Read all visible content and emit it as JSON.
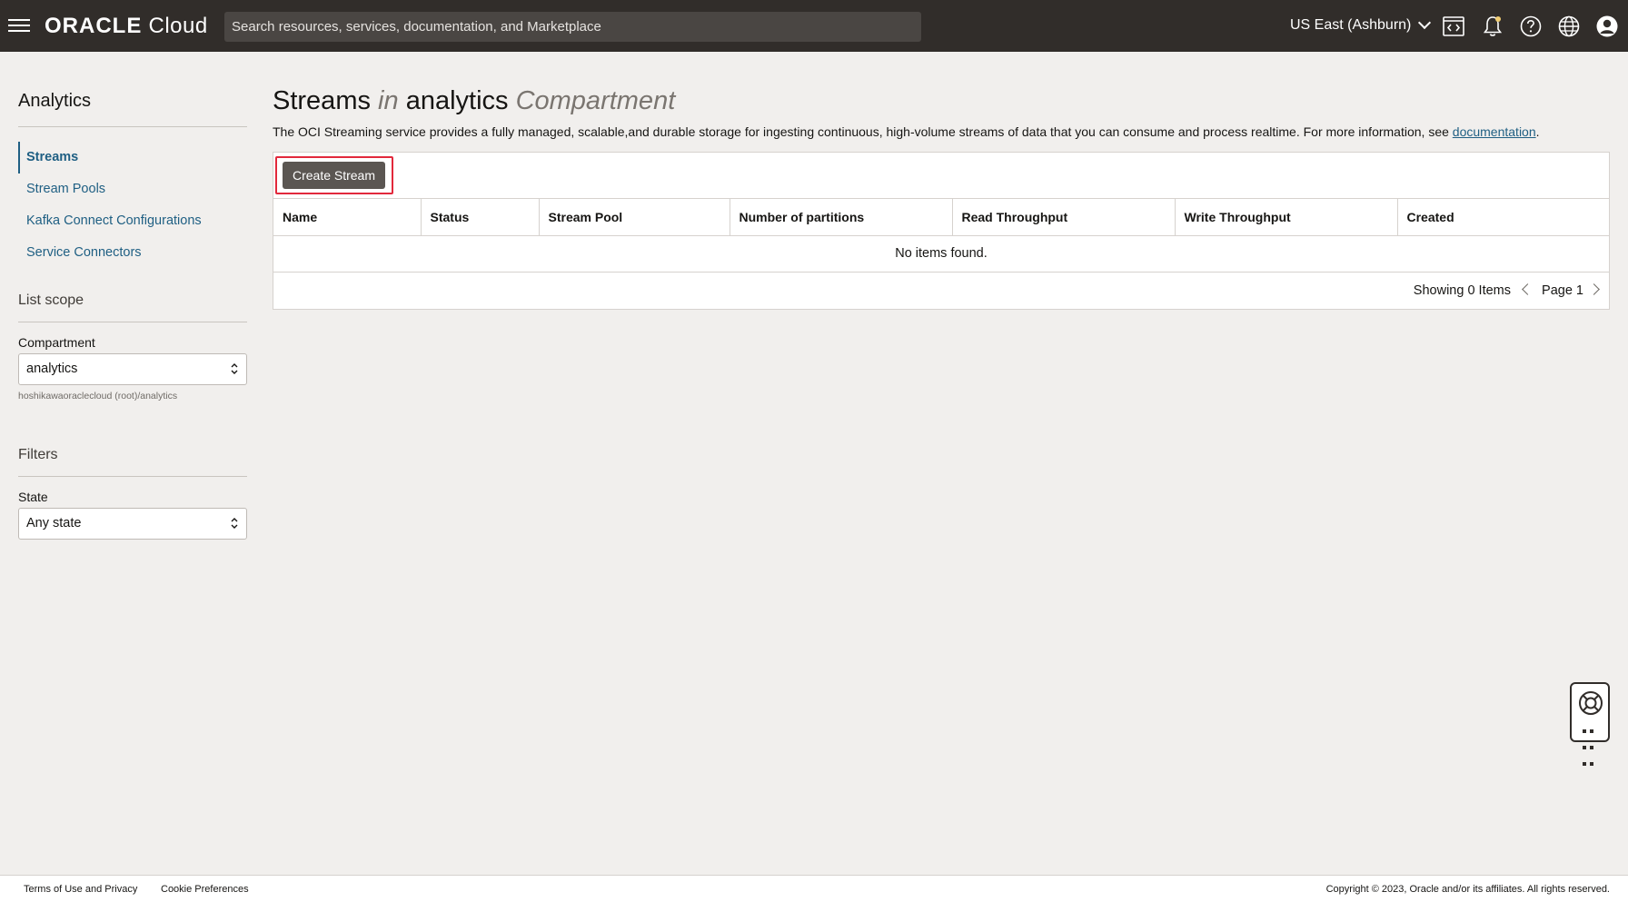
{
  "topbar": {
    "brand": "ORACLE",
    "cloud": "Cloud",
    "search_placeholder": "Search resources, services, documentation, and Marketplace",
    "region": "US East (Ashburn)"
  },
  "sidebar": {
    "title": "Analytics",
    "items": [
      {
        "label": "Streams",
        "active": true
      },
      {
        "label": "Stream Pools"
      },
      {
        "label": "Kafka Connect Configurations"
      },
      {
        "label": "Service Connectors"
      }
    ],
    "list_scope": {
      "title": "List scope",
      "compartment_label": "Compartment",
      "compartment_value": "analytics",
      "compartment_path": "hoshikawaoraclecloud (root)/analytics"
    },
    "filters": {
      "title": "Filters",
      "state_label": "State",
      "state_value": "Any state"
    }
  },
  "main": {
    "title_main": "Streams",
    "title_in": "in",
    "title_name": "analytics",
    "title_comp": "Compartment",
    "description": "The OCI Streaming service provides a fully managed, scalable,and durable storage for ingesting continuous, high-volume streams of data that you can consume and process realtime. For more information, see ",
    "doc_link": "documentation",
    "create_button": "Create Stream",
    "columns": [
      "Name",
      "Status",
      "Stream Pool",
      "Number of partitions",
      "Read Throughput",
      "Write Throughput",
      "Created"
    ],
    "empty_message": "No items found.",
    "showing": "Showing 0 Items",
    "page": "Page 1"
  },
  "footer": {
    "terms": "Terms of Use and Privacy",
    "cookies": "Cookie Preferences",
    "copyright": "Copyright © 2023, Oracle and/or its affiliates. All rights reserved."
  },
  "colors": {
    "topbar": "#312d2a",
    "link": "#1f5f83",
    "highlight": "#e2283b",
    "button": "#5b5652"
  }
}
